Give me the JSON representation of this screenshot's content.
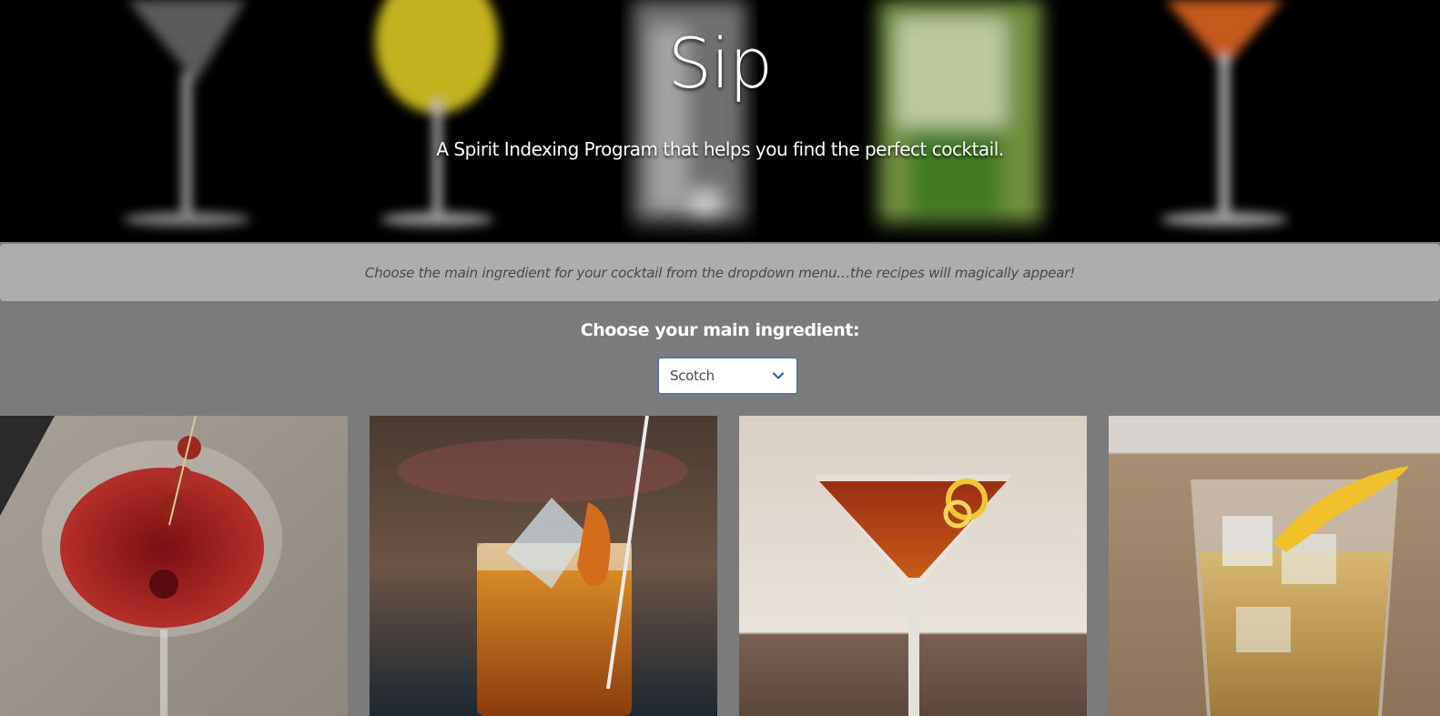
{
  "hero": {
    "title": "Sip",
    "subtitle": "A Spirit Indexing Program that helps you find the perfect cocktail."
  },
  "instructions": {
    "text": "Choose the main ingredient for your cocktail from the dropdown menu…the recipes will magically appear!"
  },
  "chooser": {
    "label": "Choose your main ingredient:",
    "selected": "Scotch"
  },
  "cocktails": [
    {
      "image": "cocktail-photo-cherry-coupe"
    },
    {
      "image": "cocktail-photo-rocks-orange-peel"
    },
    {
      "image": "cocktail-photo-martini-lemon-twist"
    },
    {
      "image": "cocktail-photo-rocks-lemon-twist"
    }
  ],
  "colors": {
    "page_bg": "#7b7b7b",
    "instructions_bg": "#adadad",
    "select_border": "#3f6ec4",
    "chevron": "#2f5fb3"
  }
}
